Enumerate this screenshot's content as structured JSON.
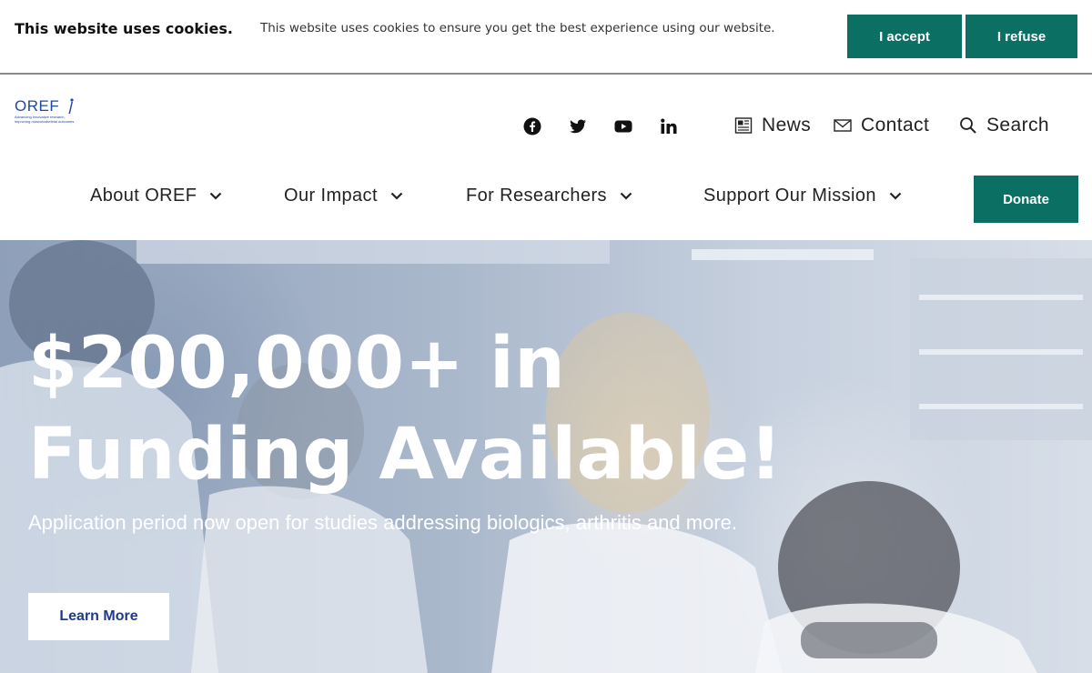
{
  "cookie": {
    "title": "This website uses cookies.",
    "message": "This website uses cookies to ensure you get the best experience using our website.",
    "accept_label": "I accept",
    "refuse_label": "I refuse"
  },
  "brand": {
    "logo_text": "OREF",
    "tagline": "Advancing innovative research, improving musculoskeletal outcomes",
    "accent_color": "#0b6f63"
  },
  "social": [
    {
      "icon": "facebook-icon"
    },
    {
      "icon": "twitter-icon"
    },
    {
      "icon": "youtube-icon"
    },
    {
      "icon": "linkedin-icon"
    }
  ],
  "utility": {
    "news_label": "News",
    "contact_label": "Contact",
    "search_label": "Search"
  },
  "nav": {
    "items": [
      {
        "label": "About OREF"
      },
      {
        "label": "Our Impact"
      },
      {
        "label": "For Researchers"
      },
      {
        "label": "Support Our Mission"
      }
    ],
    "donate_label": "Donate"
  },
  "hero": {
    "title": "$200,000+ in Funding Available!",
    "subtitle": "Application period now open for studies addressing biologics, arthritis and more.",
    "cta_label": "Learn More"
  }
}
